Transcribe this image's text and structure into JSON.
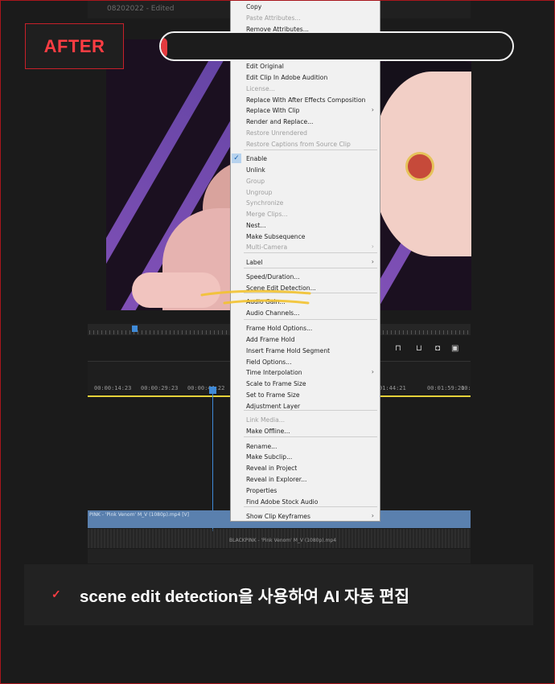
{
  "app": {
    "sequence_title": "08202022",
    "status": "- Edited"
  },
  "badge": {
    "label": "AFTER"
  },
  "timeline": {
    "timecodes": [
      "00:00:14:23",
      "00:00:29:23",
      "00:00:44:22",
      "01:44:21",
      "00:01:59:21",
      "00:"
    ],
    "clip_label": "PINK - 'Pink Venom' M_V (1080p).mp4 [V]",
    "audio_label": "BLACKPINK - 'Pink Venom' M_V (1080p).mp4"
  },
  "context_menu": {
    "items": [
      {
        "label": "Copy",
        "enabled": true
      },
      {
        "label": "Paste Attributes...",
        "enabled": false
      },
      {
        "label": "Remove Attributes...",
        "enabled": true
      },
      {
        "label": "Edit Original",
        "enabled": true
      },
      {
        "label": "Edit Clip In Adobe Audition",
        "enabled": true
      },
      {
        "label": "License...",
        "enabled": false
      },
      {
        "label": "Replace With After Effects Composition",
        "enabled": true
      },
      {
        "label": "Replace With Clip",
        "enabled": true
      },
      {
        "label": "Render and Replace...",
        "enabled": true
      },
      {
        "label": "Restore Unrendered",
        "enabled": false
      },
      {
        "label": "Restore Captions from Source Clip",
        "enabled": false
      },
      {
        "label": "Enable",
        "enabled": true,
        "checked": true
      },
      {
        "label": "Unlink",
        "enabled": true
      },
      {
        "label": "Group",
        "enabled": false
      },
      {
        "label": "Ungroup",
        "enabled": false
      },
      {
        "label": "Synchronize",
        "enabled": false
      },
      {
        "label": "Merge Clips...",
        "enabled": false
      },
      {
        "label": "Nest...",
        "enabled": true
      },
      {
        "label": "Make Subsequence",
        "enabled": true
      },
      {
        "label": "Multi-Camera",
        "enabled": false
      },
      {
        "label": "Label",
        "enabled": true
      },
      {
        "label": "Speed/Duration...",
        "enabled": true
      },
      {
        "label": "Scene Edit Detection...",
        "enabled": true
      },
      {
        "label": "Audio Gain...",
        "enabled": true
      },
      {
        "label": "Audio Channels...",
        "enabled": true
      },
      {
        "label": "Frame Hold Options...",
        "enabled": true
      },
      {
        "label": "Add Frame Hold",
        "enabled": true
      },
      {
        "label": "Insert Frame Hold Segment",
        "enabled": true
      },
      {
        "label": "Field Options...",
        "enabled": true
      },
      {
        "label": "Time Interpolation",
        "enabled": true
      },
      {
        "label": "Scale to Frame Size",
        "enabled": true
      },
      {
        "label": "Set to Frame Size",
        "enabled": true
      },
      {
        "label": "Adjustment Layer",
        "enabled": true
      },
      {
        "label": "Link Media...",
        "enabled": false
      },
      {
        "label": "Make Offline...",
        "enabled": true
      },
      {
        "label": "Rename...",
        "enabled": true
      },
      {
        "label": "Make Subclip...",
        "enabled": true
      },
      {
        "label": "Reveal in Project",
        "enabled": true
      },
      {
        "label": "Reveal in Explorer...",
        "enabled": true
      },
      {
        "label": "Properties",
        "enabled": true
      },
      {
        "label": "Find Adobe Stock Audio",
        "enabled": true
      },
      {
        "label": "Show Clip Keyframes",
        "enabled": true
      }
    ]
  },
  "caption": {
    "text": "scene edit detection을 사용하여 AI 자동 편집"
  },
  "colors": {
    "accent": "#ff3d43",
    "menu_bg": "#f1f1f1",
    "highlight": "#f2c230"
  }
}
